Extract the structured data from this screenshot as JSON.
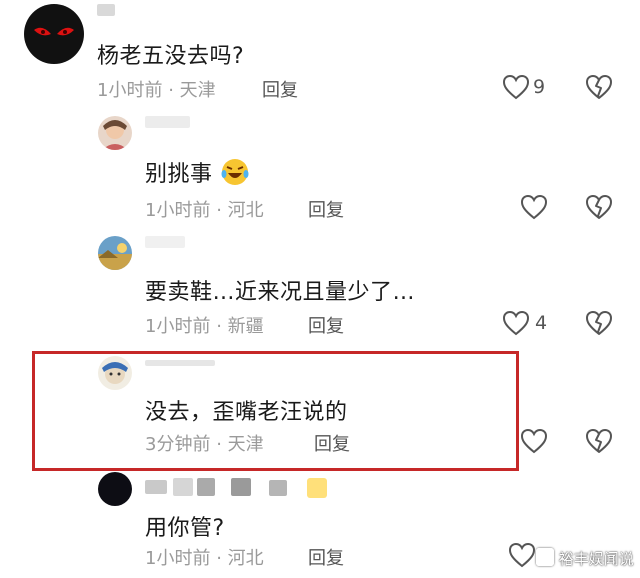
{
  "comments": [
    {
      "text": "杨老五没去吗?",
      "time": "1小时前",
      "location": "天津",
      "reply": "回复",
      "likes": "9"
    },
    {
      "text": "别挑事",
      "time": "1小时前",
      "location": "河北",
      "reply": "回复",
      "likes": ""
    },
    {
      "text": "要卖鞋…近来况且量少了…",
      "time": "1小时前",
      "location": "新疆",
      "reply": "回复",
      "likes": "4"
    },
    {
      "text": "没去，歪嘴老汪说的",
      "time": "3分钟前",
      "location": "天津",
      "reply": "回复",
      "likes": ""
    },
    {
      "text": "用你管?",
      "time": "1小时前",
      "location": "河北",
      "reply": "回复",
      "likes": ""
    }
  ],
  "meta_separator": "·",
  "watermark": "裕丰娱闻说",
  "colors": {
    "highlight": "#c62828",
    "meta": "#9a9a9a"
  }
}
